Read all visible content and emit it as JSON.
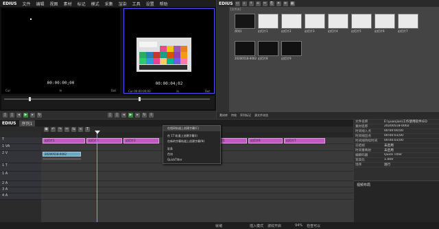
{
  "app": {
    "logo": "EDIUS"
  },
  "menu": [
    "文件",
    "编辑",
    "视图",
    "素材",
    "标记",
    "模式",
    "采集",
    "渲染",
    "工具",
    "设置",
    "帮助"
  ],
  "player": {
    "timecode": "00:00:00;00",
    "cur_label": "Cur",
    "in_label": "In",
    "out_label": "Out"
  },
  "recorder": {
    "timecode": "00:00:04;02",
    "cur_label": "Cur 00:00:00;00",
    "in_label": "In",
    "out_label": "Out"
  },
  "bin": {
    "toolbar_title": "EDIUS",
    "folder_label": "[文件夹]",
    "clips": [
      {
        "label": "序列1"
      },
      {
        "label": "幻灯片1"
      },
      {
        "label": "幻灯片2"
      },
      {
        "label": "幻灯片3"
      },
      {
        "label": "幻灯片4"
      },
      {
        "label": "幻灯片5"
      },
      {
        "label": "幻灯片6"
      },
      {
        "label": "幻灯片7"
      },
      {
        "label": "20200518-0002"
      },
      {
        "label": "幻灯片8"
      },
      {
        "label": "幻灯片9"
      }
    ],
    "tabs": [
      "素材库",
      "特效",
      "序列标记",
      "源文件浏览"
    ]
  },
  "timeline": {
    "logo": "EDIUS",
    "sequence_tab": "序列1",
    "tracks": [
      {
        "name": "T"
      },
      {
        "name": "1 VA"
      },
      {
        "name": "2 V"
      },
      {
        "name": "1 T"
      },
      {
        "name": "1 A"
      },
      {
        "name": "2 A"
      },
      {
        "name": "3 A"
      },
      {
        "name": "4 A"
      }
    ],
    "clips_title": [
      "幻灯片1",
      "幻灯片2",
      "幻灯片3",
      "幻灯片4",
      "幻灯片5",
      "幻灯片6",
      "幻灯片7"
    ],
    "clip_video": "20200518-0002"
  },
  "context_menu": {
    "items": [
      {
        "label": "在相同轨道上创建字幕(C)"
      },
      {
        "label": "在 1T 轨道上创建字幕(I)"
      },
      {
        "label": "在新的字幕轨道上创建字幕(N)"
      },
      {
        "label": "彩条"
      },
      {
        "label": "色块"
      },
      {
        "label": "QuickTitler"
      }
    ]
  },
  "info": {
    "rows": [
      {
        "k": "文件名称",
        "v": "E:\\yuanjian\\工作使用软件\\ED"
      },
      {
        "k": "素材名称",
        "v": "20200518-0002"
      },
      {
        "k": "时间线入点",
        "v": "00:00:00;00"
      },
      {
        "k": "时间线出点",
        "v": "00:00:03;00"
      },
      {
        "k": "时间线持续时间",
        "v": "00:00:03;00"
      },
      {
        "k": "冻结帧",
        "v": "未启用"
      },
      {
        "k": "时间重映射",
        "v": "未启用"
      },
      {
        "k": "编解码器",
        "v": "Quick Titler"
      },
      {
        "k": "宽高比",
        "v": "1.000"
      },
      {
        "k": "场序",
        "v": "逐行"
      }
    ],
    "fx_label": "视频布局"
  },
  "status": {
    "left": "就绪",
    "mode": "插入模式",
    "sync": "波纹开启",
    "zoom": "94%",
    "extra": "检查可以"
  }
}
